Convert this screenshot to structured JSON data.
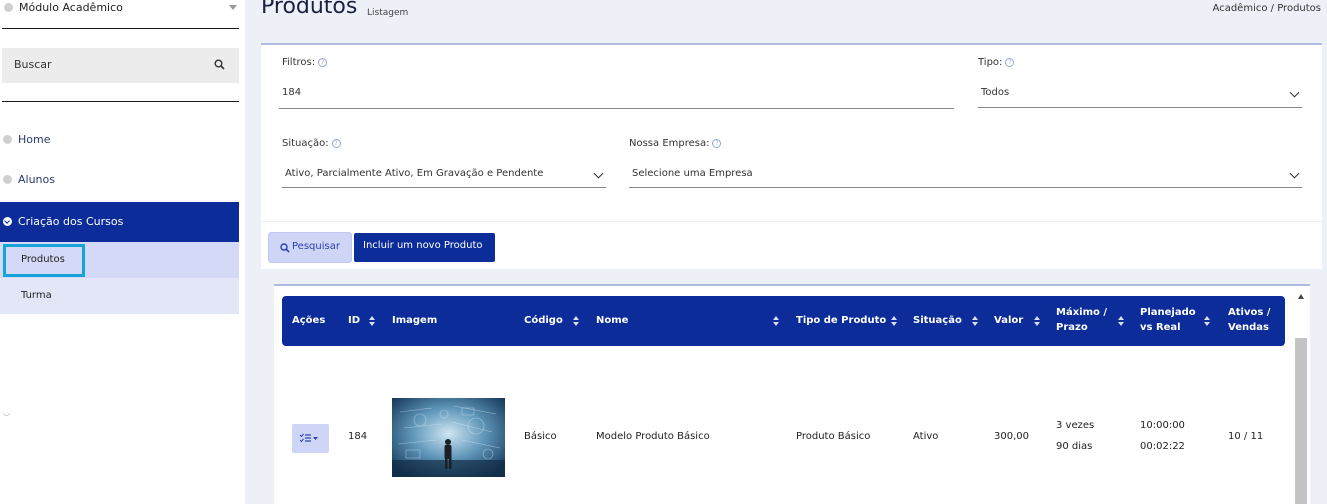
{
  "sidebar": {
    "module": "Módulo Acadêmico",
    "search_label": "Buscar",
    "items": [
      {
        "label": "Home"
      },
      {
        "label": "Alunos"
      },
      {
        "label": "Criação dos Cursos"
      }
    ],
    "subitems": [
      {
        "label": "Produtos"
      },
      {
        "label": "Turma"
      }
    ]
  },
  "header": {
    "title": "Produtos",
    "subtitle": "Listagem",
    "breadcrumb": "Acadêmico /  Produtos"
  },
  "filters": {
    "filtros_label": "Filtros:",
    "filtros_value": "184",
    "tipo_label": "Tipo:",
    "tipo_value": "Todos",
    "situacao_label": "Situação:",
    "situacao_value": "Ativo, Parcialmente Ativo, Em Gravação e Pendente",
    "empresa_label": "Nossa Empresa:",
    "empresa_value": "Selecione uma Empresa",
    "help_glyph": "?",
    "pesquisar_label": "Pesquisar",
    "novo_label": "Incluir um novo Produto"
  },
  "table": {
    "headers": {
      "acoes": "Ações",
      "id": "ID",
      "imagem": "Imagem",
      "codigo": "Código",
      "nome": "Nome",
      "tipo": "Tipo de Produto",
      "situacao": "Situação",
      "valor": "Valor",
      "maximo_1": "Máximo /",
      "maximo_2": "Prazo",
      "planejado_1": "Planejado",
      "planejado_2": "vs Real",
      "ativos_1": "Ativos /",
      "ativos_2": "Vendas"
    },
    "rows": [
      {
        "id": "184",
        "codigo": "Básico",
        "nome": "Modelo Produto Básico",
        "tipo": "Produto Básico",
        "situacao": "Ativo",
        "valor": "300,00",
        "maximo": "3 vezes",
        "prazo": "90 dias",
        "planejado": "10:00:00",
        "real": "00:02:22",
        "ativos_vendas": "10 / 11"
      }
    ]
  },
  "icons": {
    "search": "search-icon",
    "actions": "list-check-icon",
    "help": "question-circle-icon"
  },
  "colors": {
    "primary": "#0b2c99",
    "highlight": "#16a3d8",
    "light_primary": "#cfd5f6"
  }
}
